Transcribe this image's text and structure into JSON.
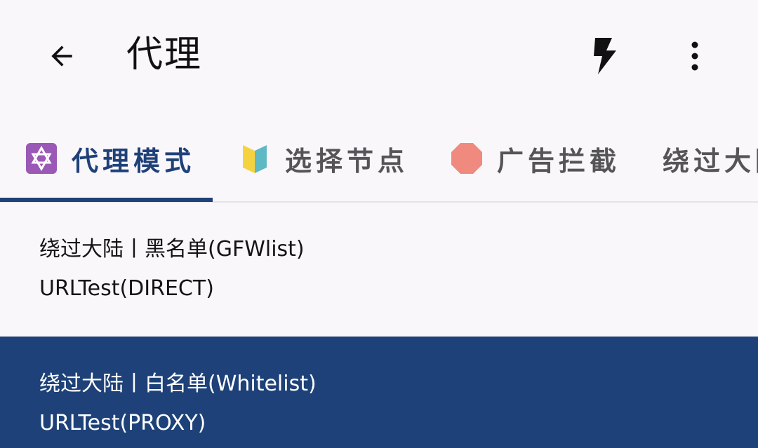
{
  "topbar": {
    "title": "代理",
    "back_icon": "arrow-back-icon",
    "actions": [
      {
        "name": "flash-icon"
      },
      {
        "name": "more-vert-icon"
      }
    ]
  },
  "tabs": [
    {
      "label": "代理模式",
      "icon": "star-of-david-icon",
      "active": true
    },
    {
      "label": "选择节点",
      "icon": "beginner-badge-icon",
      "active": false
    },
    {
      "label": "广告拦截",
      "icon": "stop-sign-icon",
      "active": false
    },
    {
      "label": "绕过大陆",
      "icon": "",
      "active": false
    }
  ],
  "list": {
    "items": [
      {
        "title": "绕过大陆丨黑名单(GFWlist)",
        "subtitle": "URLTest(DIRECT)",
        "selected": false
      },
      {
        "title": "绕过大陆丨白名单(Whitelist)",
        "subtitle": "URLTest(PROXY)",
        "selected": true
      }
    ]
  },
  "colors": {
    "background": "#faf7fb",
    "accent": "#1f4178",
    "selected_row": "#1d4178"
  }
}
